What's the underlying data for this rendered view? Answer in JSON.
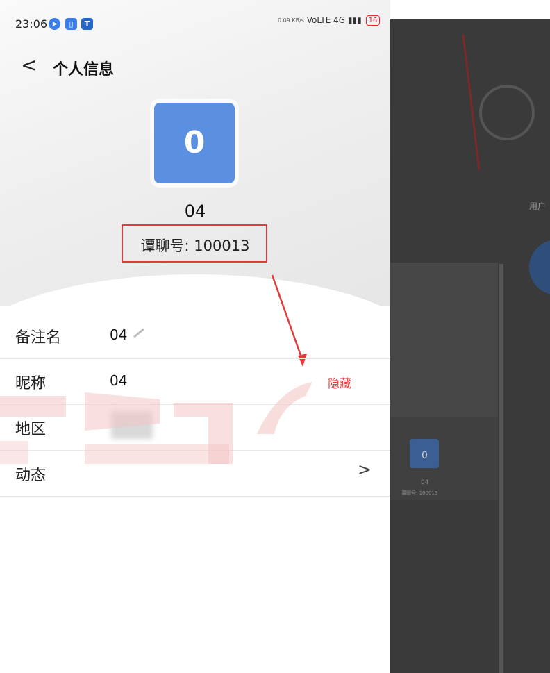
{
  "status_bar": {
    "time": "23:06",
    "net_speed": "0.09\nKB/s",
    "network": "VoLTE 4G",
    "battery": "16"
  },
  "header": {
    "back_icon": "chevron-left-icon",
    "title": "个人信息"
  },
  "profile": {
    "avatar_letter": "0",
    "avatar_color": "#5b8fe0",
    "name": "04",
    "id_line": "谭聊号: 100013"
  },
  "annotation": {
    "text": "隐藏",
    "color": "#e23a3a"
  },
  "rows": [
    {
      "label": "备注名",
      "value": "04",
      "icon": "pencil-icon"
    },
    {
      "label": "昵称",
      "value": "04"
    },
    {
      "label": "地区",
      "value": ""
    },
    {
      "label": "动态",
      "value": "",
      "chevron": ">"
    }
  ],
  "background_panel": {
    "header_text": "用户",
    "card_avatar": "0",
    "card_name": "04",
    "card_id": "谭聊号: 100013"
  }
}
